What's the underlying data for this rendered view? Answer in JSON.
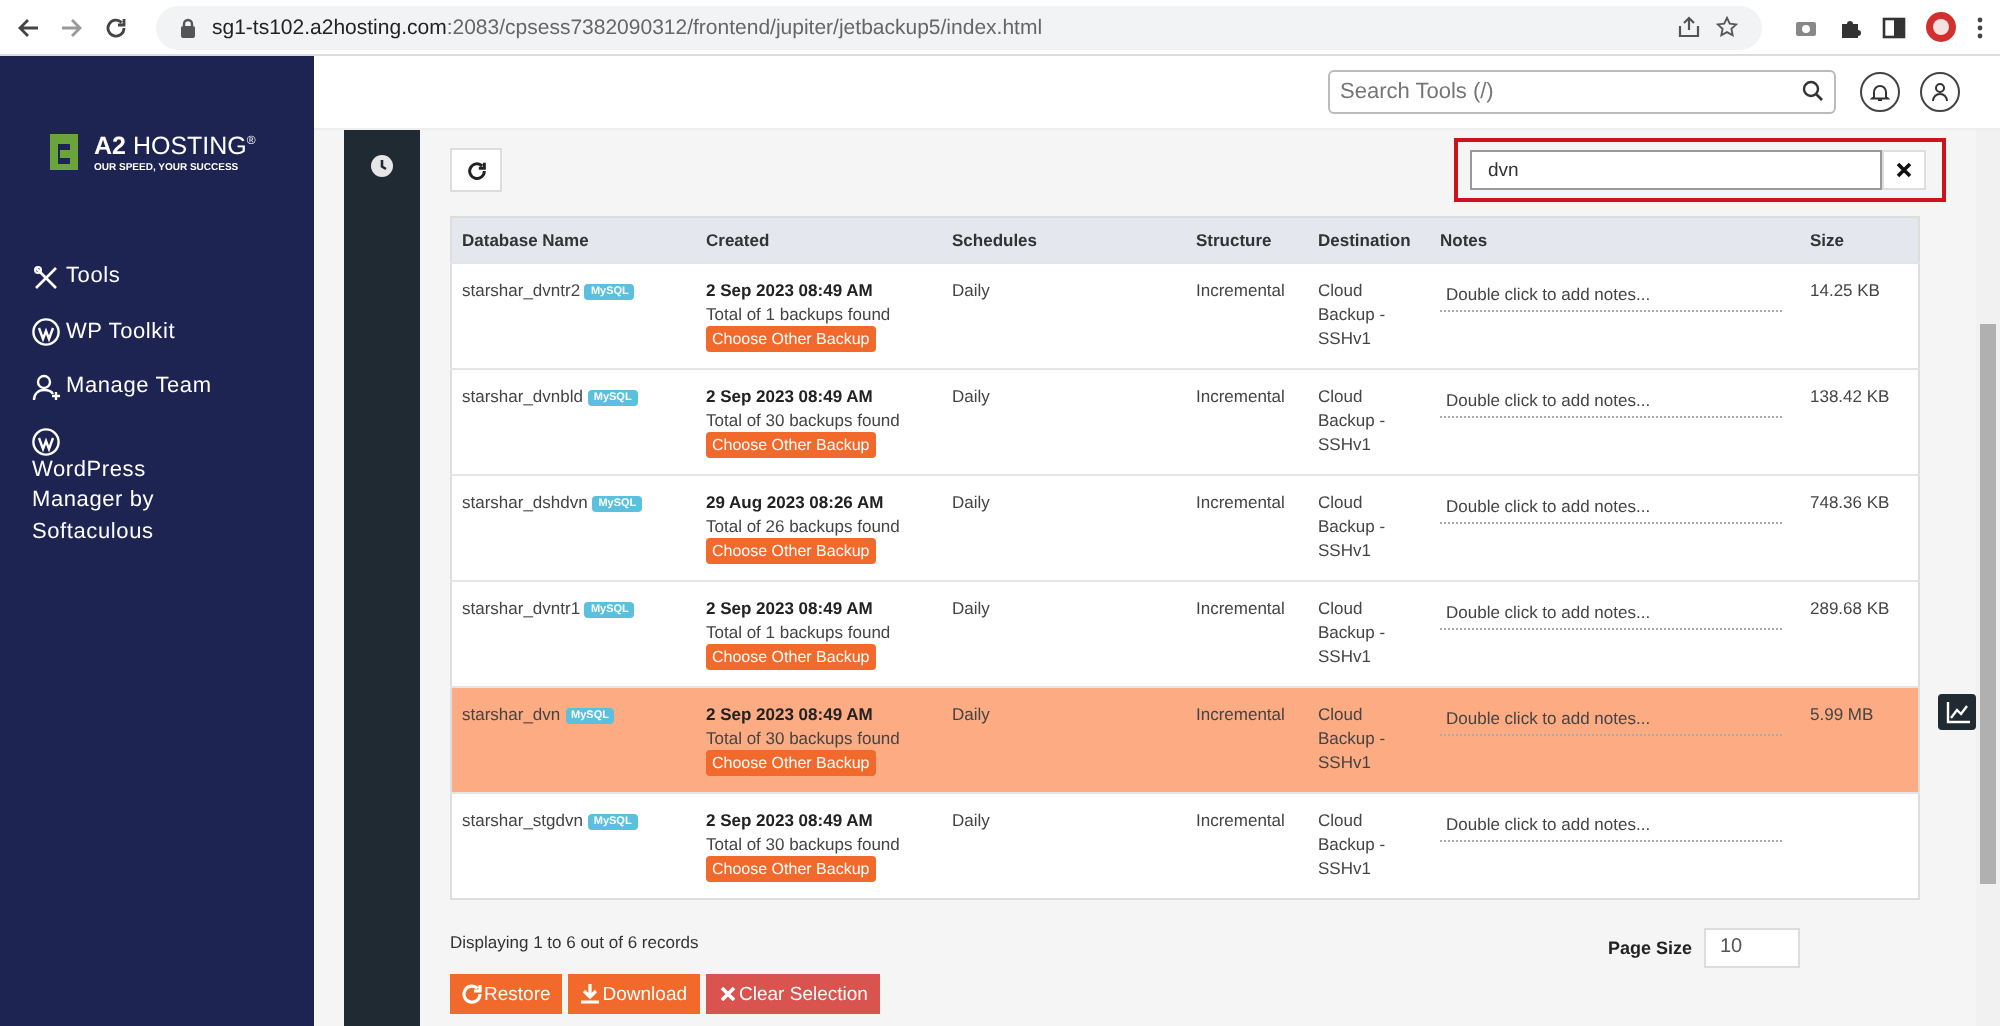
{
  "browser": {
    "url_host": "sg1-ts102.a2hosting.com",
    "url_path": ":2083/cpsess7382090312/frontend/jupiter/jetbackup5/index.html"
  },
  "sidebar": {
    "logo": {
      "brand": "**A2** HOSTING$^{®}$",
      "tagline": "OUR SPEED, YOUR SUCCESS"
    },
    "items": [
      {
        "label": "Tools",
        "kind": "tools"
      },
      {
        "label": "WP Toolkit",
        "kind": "wordpress"
      },
      {
        "label": "Manage Team",
        "kind": "team"
      },
      {
        "label": "WordPress Manager by Softaculous",
        "kind": "wordpress"
      }
    ]
  },
  "header": {
    "search": {
      "placeholder": "Search Tools (/)"
    }
  },
  "filter": {
    "value": "dvn",
    "highlighted": true
  },
  "table": {
    "columns": [
      "Database Name",
      "Created",
      "Schedules",
      "Structure",
      "Destination",
      "Notes",
      "Size"
    ],
    "rows": [
      {
        "name": "starshar_dvntr2",
        "badge": "MySQL",
        "created": "2 Sep 2023 08:49 AM",
        "total": "Total of 1 backups found",
        "action": "Choose Other Backup",
        "schedule": "Daily",
        "structure": "Incremental",
        "destination": "Cloud Backup - SSHv1",
        "notes": "Double click to add notes...",
        "size": "14.25 KB",
        "selected": false
      },
      {
        "name": "starshar_dvnbld",
        "badge": "MySQL",
        "created": "2 Sep 2023 08:49 AM",
        "total": "Total of 30 backups found",
        "action": "Choose Other Backup",
        "schedule": "Daily",
        "structure": "Incremental",
        "destination": "Cloud Backup - SSHv1",
        "notes": "Double click to add notes...",
        "size": "138.42 KB",
        "selected": false
      },
      {
        "name": "starshar_dshdvn",
        "badge": "MySQL",
        "created": "29 Aug 2023 08:26 AM",
        "total": "Total of 26 backups found",
        "action": "Choose Other Backup",
        "schedule": "Daily",
        "structure": "Incremental",
        "destination": "Cloud Backup - SSHv1",
        "notes": "Double click to add notes...",
        "size": "748.36 KB",
        "selected": false
      },
      {
        "name": "starshar_dvntr1",
        "badge": "MySQL",
        "created": "2 Sep 2023 08:49 AM",
        "total": "Total of 1 backups found",
        "action": "Choose Other Backup",
        "schedule": "Daily",
        "structure": "Incremental",
        "destination": "Cloud Backup - SSHv1",
        "notes": "Double click to add notes...",
        "size": "289.68 KB",
        "selected": false
      },
      {
        "name": "starshar_dvn",
        "badge": "MySQL",
        "created": "2 Sep 2023 08:49 AM",
        "total": "Total of 30 backups found",
        "action": "Choose Other Backup",
        "schedule": "Daily",
        "structure": "Incremental",
        "destination": "Cloud Backup - SSHv1",
        "notes": "Double click to add notes...",
        "size": "5.99 MB",
        "selected": true
      },
      {
        "name": "starshar_stgdvn",
        "badge": "MySQL",
        "created": "2 Sep 2023 08:49 AM",
        "total": "Total of 30 backups found",
        "action": "Choose Other Backup",
        "schedule": "Daily",
        "structure": "Incremental",
        "destination": "Cloud Backup - SSHv1",
        "notes": "Double click to add notes...",
        "size": "",
        "selected": false
      }
    ]
  },
  "footer": {
    "records": "Displaying 1 to 6 out of 6 records",
    "page_size_label": "Page Size",
    "page_size": "10"
  },
  "actions": [
    {
      "label": "Restore",
      "kind": "restore"
    },
    {
      "label": "Download",
      "kind": "download"
    },
    {
      "label": "Clear Selection",
      "kind": "clear"
    }
  ]
}
